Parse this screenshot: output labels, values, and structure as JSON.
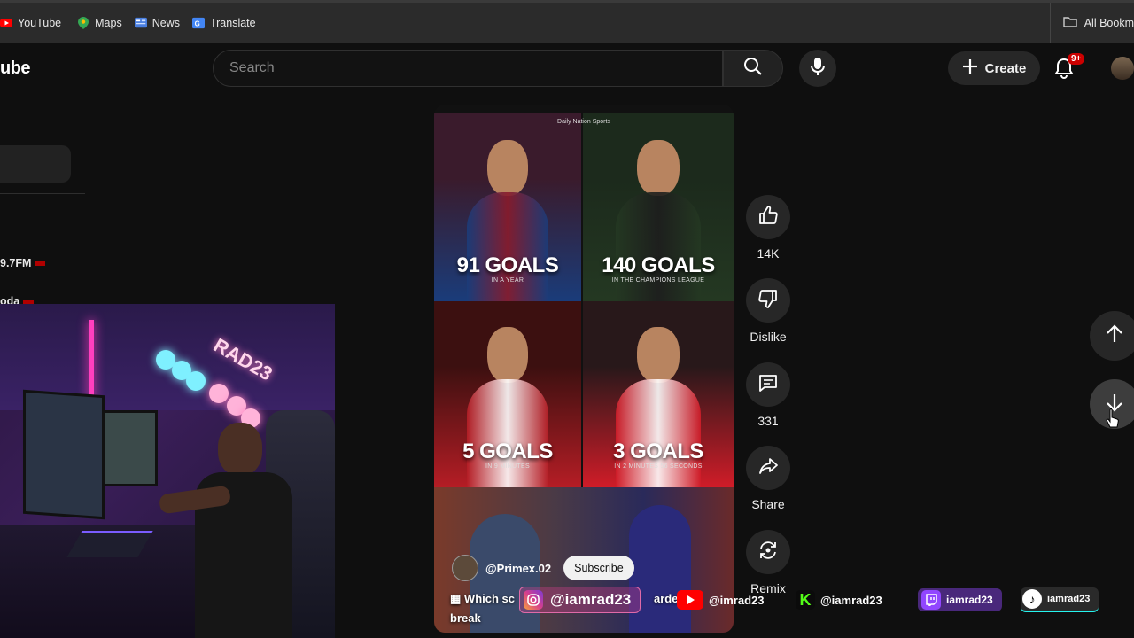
{
  "bookmarks": {
    "items": [
      {
        "label": "YouTube",
        "icon": "youtube-icon"
      },
      {
        "label": "Maps",
        "icon": "maps-icon"
      },
      {
        "label": "News",
        "icon": "news-icon"
      },
      {
        "label": "Translate",
        "icon": "translate-icon"
      }
    ],
    "all_bookmarks": "All Bookm"
  },
  "header": {
    "logo_text": "ube",
    "search_placeholder": "Search",
    "create_label": "Create",
    "notification_count": "9+"
  },
  "sidebar": {
    "items": [
      {
        "label": "9.7FM",
        "live": true
      },
      {
        "label": "oda",
        "live": true
      }
    ]
  },
  "shorts": {
    "source_label": "Daily Nation Sports",
    "tiles": [
      {
        "headline": "91 GOALS",
        "sub": "IN A YEAR",
        "colors": [
          "#3a1b2c",
          "#1a3c7a",
          "#8a1b2b"
        ]
      },
      {
        "headline": "140 GOALS",
        "sub": "IN THE CHAMPIONS LEAGUE",
        "colors": [
          "#1c2a1c",
          "#243822",
          "#1d1d1d"
        ]
      },
      {
        "headline": "5 GOALS",
        "sub": "IN 9 MINUTES",
        "colors": [
          "#3c1010",
          "#b51d25",
          "#ffffff"
        ]
      },
      {
        "headline": "3 GOALS",
        "sub": "IN 2 MINUTES 56 SECONDS",
        "colors": [
          "#28181a",
          "#d01c28",
          "#ffffff"
        ]
      }
    ],
    "channel_handle": "@Primex.02",
    "subscribe_label": "Subscribe",
    "desc_line1": "Which sc",
    "desc_line1b": "ardes",
    "desc_line2": "break"
  },
  "actions": {
    "like": "14K",
    "dislike": "Dislike",
    "comments": "331",
    "share": "Share",
    "remix": "Remix"
  },
  "socials": [
    {
      "platform": "instagram",
      "handle": "@iamrad23",
      "color": "#d63f8c"
    },
    {
      "platform": "youtube",
      "handle": "@imrad23",
      "color": "#ff0000"
    },
    {
      "platform": "kick",
      "handle": "@iamrad23",
      "color": "#53fc18"
    },
    {
      "platform": "twitch",
      "handle": "iamrad23",
      "color": "#9146ff"
    },
    {
      "platform": "tiktok",
      "handle": "iamrad23",
      "color": "#ffffff"
    }
  ],
  "webcam": {
    "neon_sign": "RAD23"
  }
}
